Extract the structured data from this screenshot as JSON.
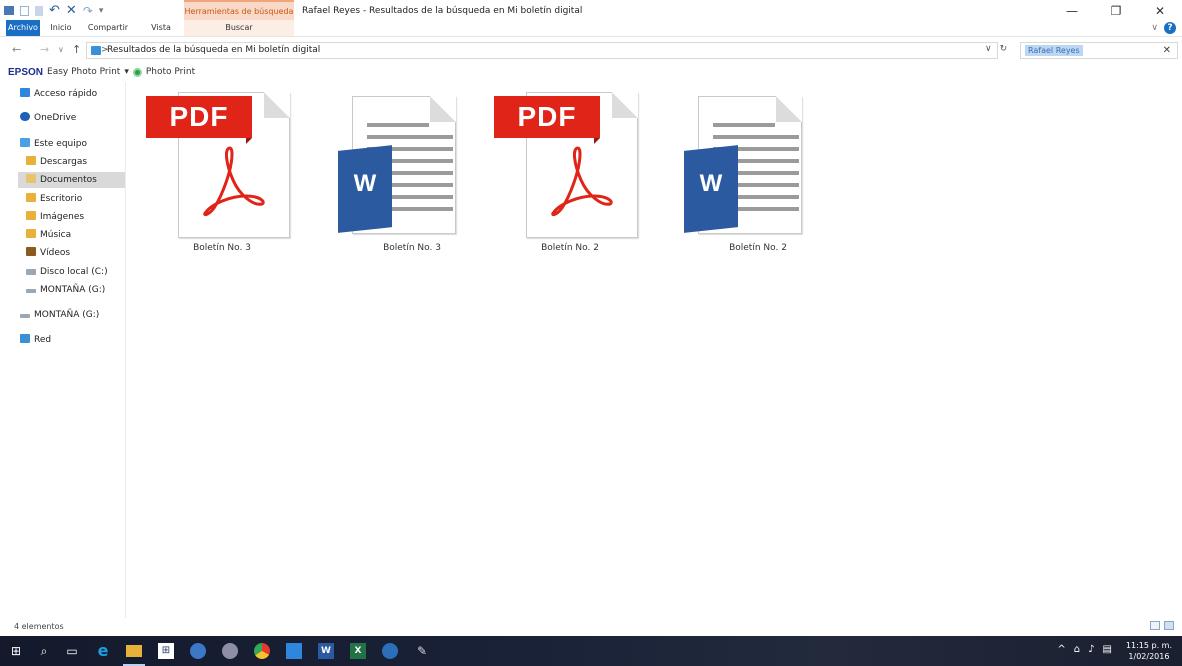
{
  "window": {
    "title": "Rafael Reyes - Resultados de la búsqueda en Mi boletín digital",
    "context_tab_header": "Herramientas de búsqueda",
    "minimize": "—",
    "maximize": "❐",
    "close": "✕"
  },
  "ribbon": {
    "tabs": [
      {
        "label": "Archivo"
      },
      {
        "label": "Inicio"
      },
      {
        "label": "Compartir"
      },
      {
        "label": "Vista"
      },
      {
        "label": "Buscar"
      }
    ],
    "expand_glyph": "∨",
    "help_glyph": "?"
  },
  "address": {
    "back": "←",
    "forward": "→",
    "recent": "∨",
    "up": "↑",
    "separator": ">",
    "path": "Resultados de la búsqueda en Mi boletín digital",
    "dropdown": "∨",
    "refresh": "↻",
    "search_value": "Rafael Reyes",
    "search_clear": "✕"
  },
  "epson": {
    "brand": "EPSON",
    "easy_photo_print": "Easy Photo Print",
    "dropdown": "▾",
    "photo_print": "Photo Print"
  },
  "nav": {
    "items": [
      {
        "label": "Acceso rápido",
        "icon": "star-icon",
        "color": "#2e86de"
      },
      {
        "label": "OneDrive",
        "icon": "cloud-icon",
        "color": "#1d62b8"
      },
      {
        "label": "Este equipo",
        "icon": "computer-icon",
        "color": "#4aa0e6"
      },
      {
        "label": "Descargas",
        "icon": "download-folder-icon",
        "color": "#e8b23a"
      },
      {
        "label": "Documentos",
        "icon": "documents-folder-icon",
        "color": "#e8c46a"
      },
      {
        "label": "Escritorio",
        "icon": "desktop-folder-icon",
        "color": "#e8b23a"
      },
      {
        "label": "Imágenes",
        "icon": "pictures-folder-icon",
        "color": "#e8b23a"
      },
      {
        "label": "Música",
        "icon": "music-folder-icon",
        "color": "#e8b23a"
      },
      {
        "label": "Vídeos",
        "icon": "videos-folder-icon",
        "color": "#e8b23a"
      },
      {
        "label": "Disco local (C:)",
        "icon": "drive-icon",
        "color": "#9aa7b4"
      },
      {
        "label": "MONTAÑA (G:)",
        "icon": "usb-drive-icon",
        "color": "#9aa7b4"
      },
      {
        "label": "MONTAÑA (G:)",
        "icon": "usb-drive-icon",
        "color": "#9aa7b4"
      },
      {
        "label": "Red",
        "icon": "network-icon",
        "color": "#3b8fd9"
      }
    ]
  },
  "files": [
    {
      "name": "Boletín No. 3",
      "type": "pdf",
      "badge": "PDF"
    },
    {
      "name": "Boletín No. 3",
      "type": "word",
      "badge": "W"
    },
    {
      "name": "Boletín No. 2",
      "type": "pdf",
      "badge": "PDF"
    },
    {
      "name": "Boletín No. 2",
      "type": "word",
      "badge": "W"
    }
  ],
  "status": {
    "count": "4 elementos"
  },
  "taskbar": {
    "start_glyph": "⊞",
    "search_glyph": "⌕",
    "taskview_glyph": "▭",
    "clock_time": "11:15 p. m.",
    "clock_date": "1/02/2016",
    "tray_glyphs": [
      "^",
      "⌂",
      "♪",
      "▤"
    ]
  },
  "colors": {
    "accent": "#1a6fc4",
    "pdf_red": "#e02418",
    "word_blue": "#2c5aa0",
    "search_highlight": "#bcd7f4"
  }
}
